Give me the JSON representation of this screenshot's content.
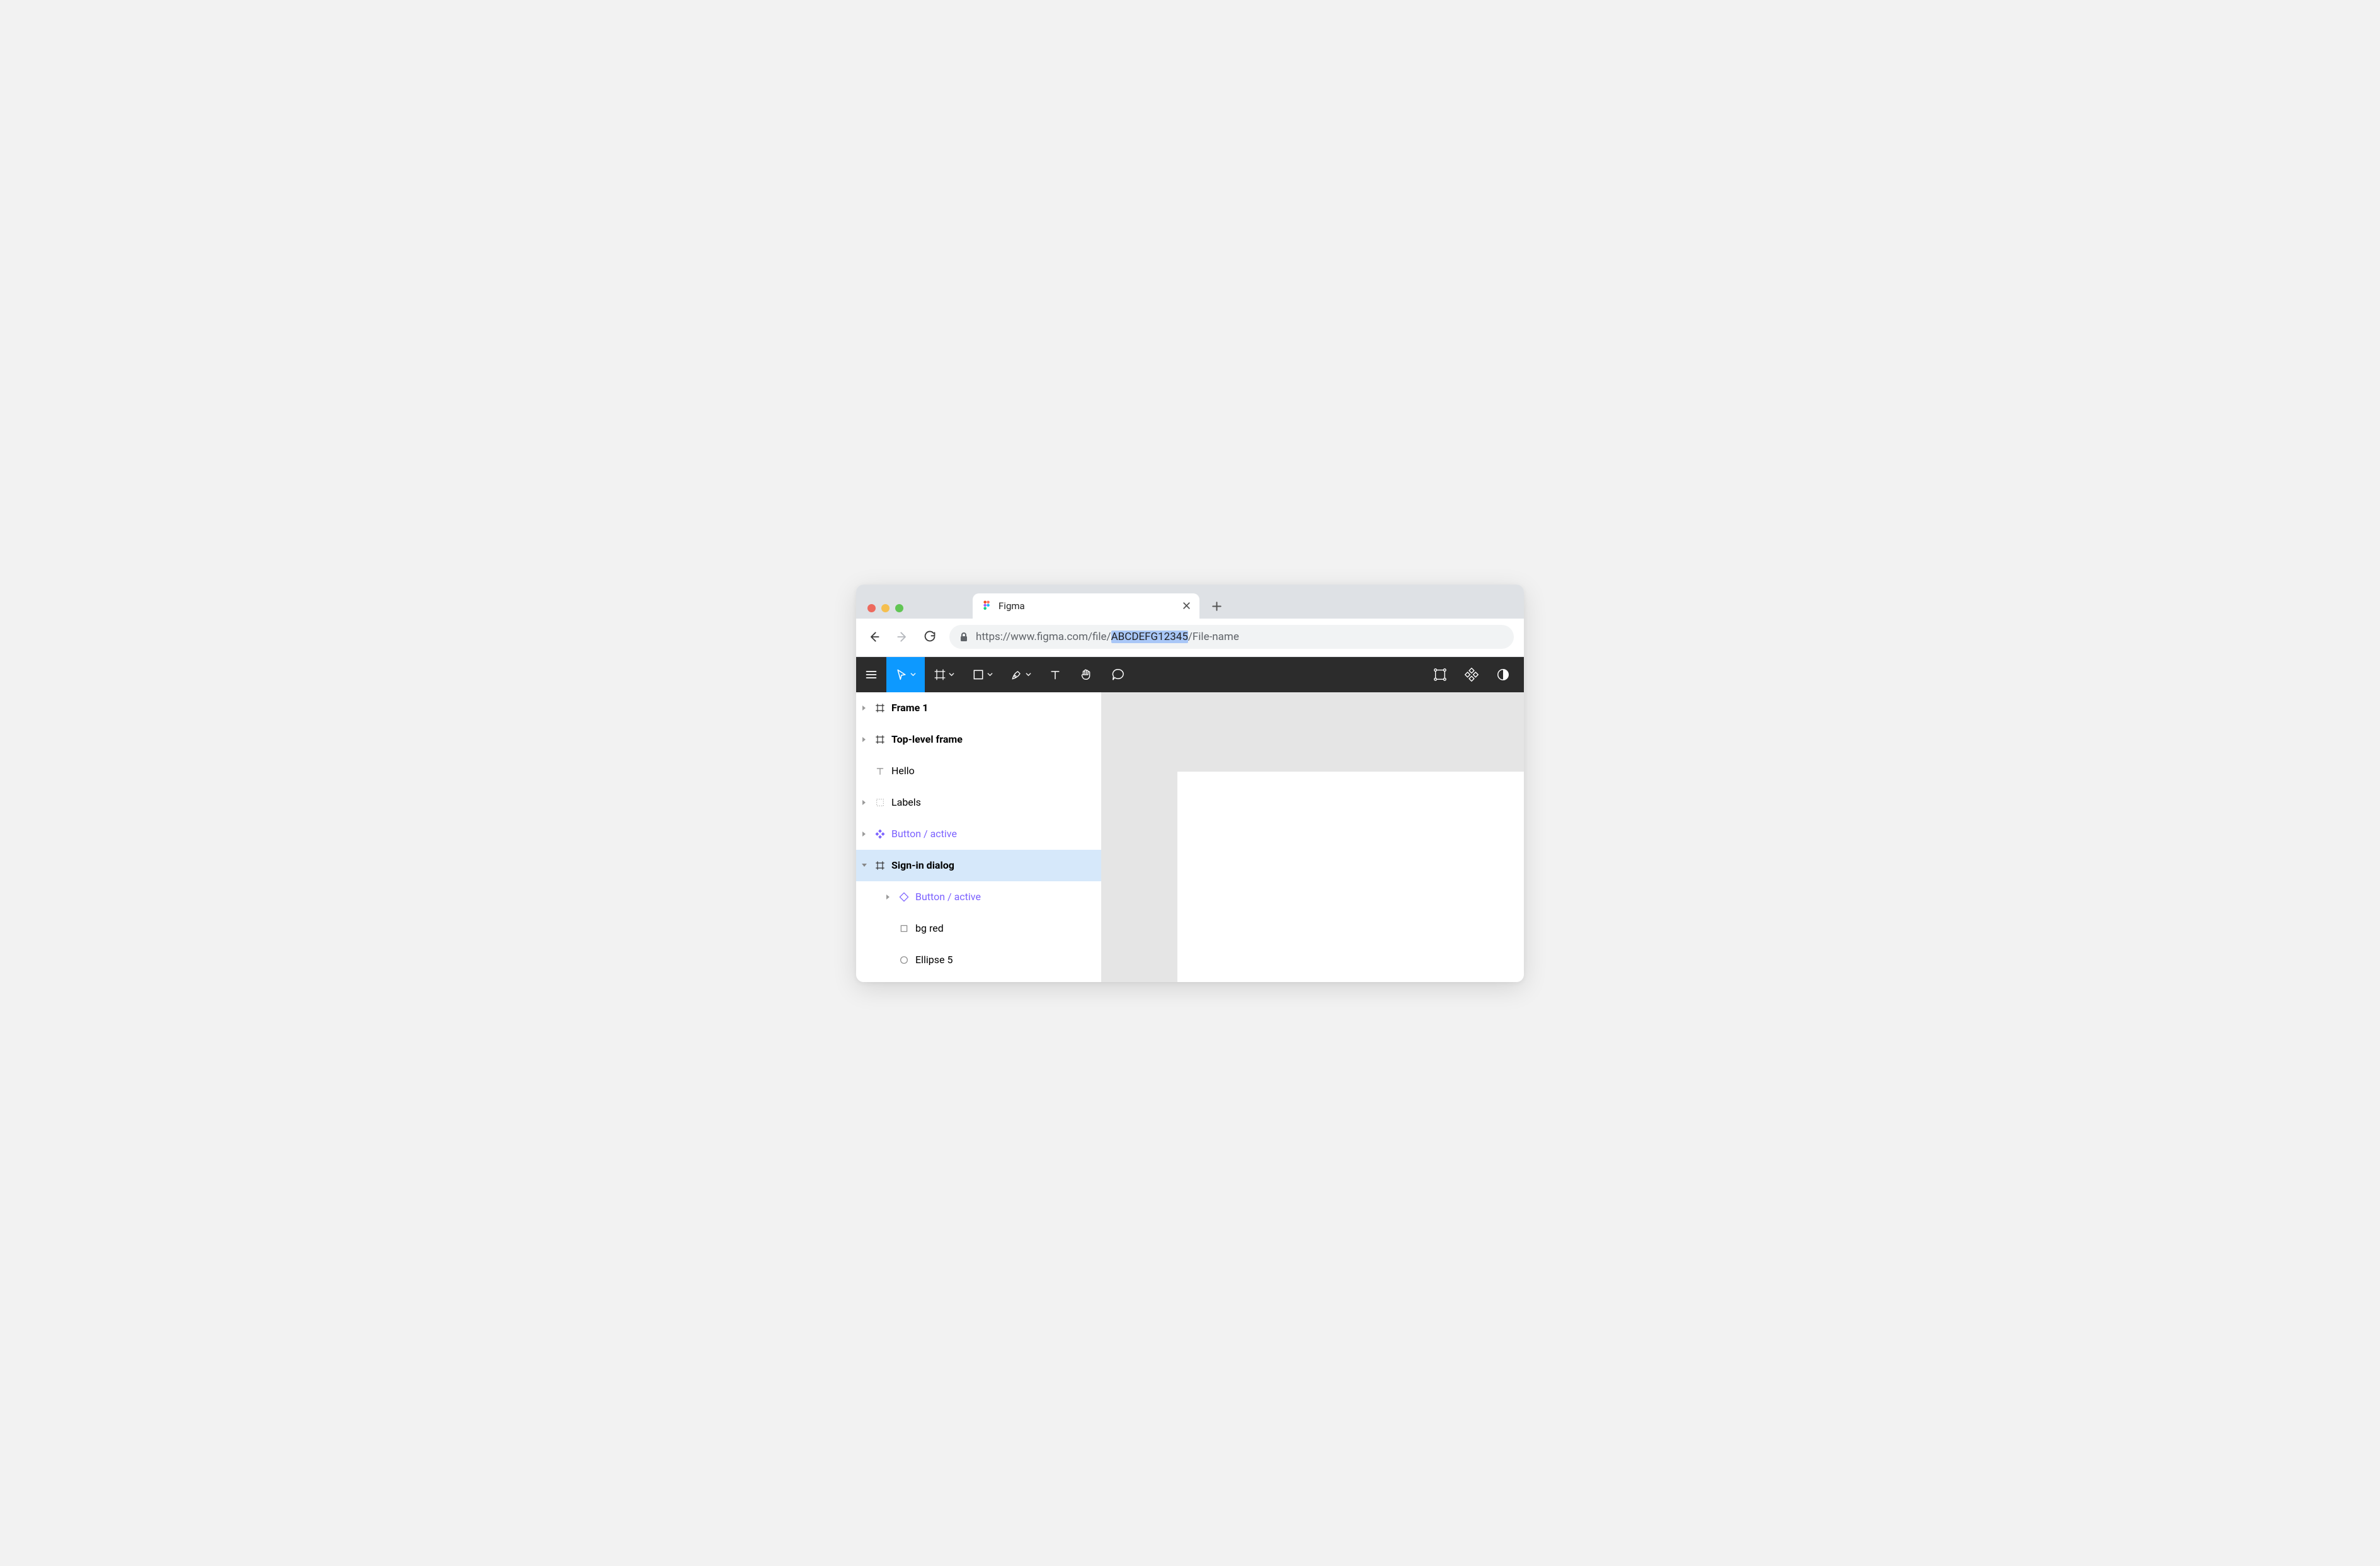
{
  "browser": {
    "tab_title": "Figma",
    "url_prefix": "https://www.figma.com/file/",
    "url_key": "ABCDEFG12345",
    "url_suffix": "/File-name"
  },
  "layers": {
    "items": [
      {
        "label": "Frame 1"
      },
      {
        "label": "Top-level frame"
      },
      {
        "label": "Hello"
      },
      {
        "label": "Labels"
      },
      {
        "label": "Button / active"
      },
      {
        "label": "Sign-in dialog"
      },
      {
        "label": "Button / active"
      },
      {
        "label": "bg red"
      },
      {
        "label": "Ellipse 5"
      }
    ]
  },
  "colors": {
    "toolbar_active": "#0d99ff",
    "component": "#7b61ff",
    "selection_bg": "#d6e8fa",
    "url_selection": "#a9c7f7"
  }
}
